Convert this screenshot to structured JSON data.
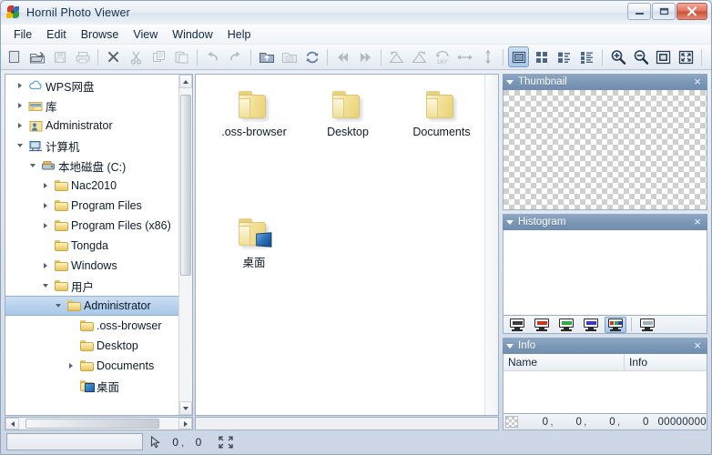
{
  "window": {
    "title": "Hornil Photo Viewer",
    "logo_icon": "hornil-pinwheel-icon",
    "minimize_label": "Minimize",
    "maximize_label": "Maximize",
    "close_label": "Close"
  },
  "menubar": {
    "items": [
      {
        "label": "File"
      },
      {
        "label": "Edit"
      },
      {
        "label": "Browse"
      },
      {
        "label": "View"
      },
      {
        "label": "Window"
      },
      {
        "label": "Help"
      }
    ]
  },
  "toolbar": {
    "groups": [
      {
        "buttons": [
          {
            "icon": "new-document-icon",
            "tip": "New",
            "enabled": true,
            "selected": false
          },
          {
            "icon": "open-folder-icon",
            "tip": "Open",
            "enabled": true,
            "selected": false
          },
          {
            "icon": "save-floppy-icon",
            "tip": "Save",
            "enabled": false,
            "selected": false
          },
          {
            "icon": "printer-icon",
            "tip": "Print",
            "enabled": false,
            "selected": false
          }
        ]
      },
      {
        "buttons": [
          {
            "icon": "delete-x-icon",
            "tip": "Delete",
            "enabled": true,
            "selected": false
          },
          {
            "icon": "scissors-cut-icon",
            "tip": "Cut",
            "enabled": false,
            "selected": false
          },
          {
            "icon": "copy-icon",
            "tip": "Copy",
            "enabled": false,
            "selected": false
          },
          {
            "icon": "paste-icon",
            "tip": "Paste",
            "enabled": false,
            "selected": false
          }
        ]
      },
      {
        "buttons": [
          {
            "icon": "undo-arrow-icon",
            "tip": "Undo",
            "enabled": false,
            "selected": false
          },
          {
            "icon": "redo-arrow-icon",
            "tip": "Redo",
            "enabled": false,
            "selected": false
          }
        ]
      },
      {
        "buttons": [
          {
            "icon": "folder-up-icon",
            "tip": "Parent folder",
            "enabled": true,
            "selected": false
          },
          {
            "icon": "folder-image-icon",
            "tip": "Image folder",
            "enabled": false,
            "selected": false
          },
          {
            "icon": "refresh-icon",
            "tip": "Refresh",
            "enabled": true,
            "selected": false
          }
        ]
      },
      {
        "buttons": [
          {
            "icon": "skip-back-icon",
            "tip": "First",
            "enabled": false,
            "selected": false
          },
          {
            "icon": "skip-forward-icon",
            "tip": "Last",
            "enabled": false,
            "selected": false
          }
        ]
      },
      {
        "buttons": [
          {
            "icon": "rotate-left-icon",
            "tip": "Rotate left",
            "enabled": false,
            "selected": false
          },
          {
            "icon": "rotate-right-icon",
            "tip": "Rotate right",
            "enabled": false,
            "selected": false
          },
          {
            "icon": "rotate-180-icon",
            "tip": "Rotate 180",
            "enabled": false,
            "selected": false
          },
          {
            "icon": "flip-horizontal-icon",
            "tip": "Flip horizontal",
            "enabled": false,
            "selected": false
          },
          {
            "icon": "flip-vertical-icon",
            "tip": "Flip vertical",
            "enabled": false,
            "selected": false
          }
        ]
      },
      {
        "buttons": [
          {
            "icon": "view-single-icon",
            "tip": "Single view",
            "enabled": true,
            "selected": true
          },
          {
            "icon": "view-grid-icon",
            "tip": "Thumbnails",
            "enabled": true,
            "selected": false
          },
          {
            "icon": "view-tiles-icon",
            "tip": "Tiles",
            "enabled": true,
            "selected": false
          },
          {
            "icon": "view-details-icon",
            "tip": "Details",
            "enabled": true,
            "selected": false
          }
        ]
      },
      {
        "buttons": [
          {
            "icon": "zoom-in-icon",
            "tip": "Zoom in",
            "enabled": true,
            "selected": false
          },
          {
            "icon": "zoom-out-icon",
            "tip": "Zoom out",
            "enabled": true,
            "selected": false
          },
          {
            "icon": "actual-size-icon",
            "tip": "Actual size",
            "enabled": true,
            "selected": false
          },
          {
            "icon": "fit-screen-icon",
            "tip": "Fit to window",
            "enabled": true,
            "selected": false
          }
        ]
      },
      {
        "buttons": [
          {
            "icon": "pen-tool-icon",
            "tip": "Edit",
            "enabled": false,
            "selected": false
          }
        ]
      }
    ]
  },
  "tree": {
    "rows": [
      {
        "label": "WPS网盘",
        "indent": 0,
        "twisty": "collapsed",
        "icon": "cloud-drive-icon",
        "selected": false
      },
      {
        "label": "库",
        "indent": 0,
        "twisty": "collapsed",
        "icon": "library-icon",
        "selected": false
      },
      {
        "label": "Administrator",
        "indent": 0,
        "twisty": "collapsed",
        "icon": "user-folder-icon",
        "selected": false
      },
      {
        "label": "计算机",
        "indent": 0,
        "twisty": "expanded",
        "icon": "computer-icon",
        "selected": false
      },
      {
        "label": "本地磁盘 (C:)",
        "indent": 1,
        "twisty": "expanded",
        "icon": "hard-disk-icon",
        "selected": false
      },
      {
        "label": "Nac2010",
        "indent": 2,
        "twisty": "collapsed",
        "icon": "folder-icon",
        "selected": false
      },
      {
        "label": "Program Files",
        "indent": 2,
        "twisty": "collapsed",
        "icon": "folder-icon",
        "selected": false
      },
      {
        "label": "Program Files (x86)",
        "indent": 2,
        "twisty": "collapsed",
        "icon": "folder-icon",
        "selected": false
      },
      {
        "label": "Tongda",
        "indent": 2,
        "twisty": "none",
        "icon": "folder-icon",
        "selected": false
      },
      {
        "label": "Windows",
        "indent": 2,
        "twisty": "collapsed",
        "icon": "folder-icon",
        "selected": false
      },
      {
        "label": "用户",
        "indent": 2,
        "twisty": "expanded",
        "icon": "folder-icon",
        "selected": false
      },
      {
        "label": "Administrator",
        "indent": 3,
        "twisty": "expanded",
        "icon": "folder-icon",
        "selected": true
      },
      {
        "label": ".oss-browser",
        "indent": 4,
        "twisty": "none",
        "icon": "folder-icon",
        "selected": false
      },
      {
        "label": "Desktop",
        "indent": 4,
        "twisty": "none",
        "icon": "folder-icon",
        "selected": false
      },
      {
        "label": "Documents",
        "indent": 4,
        "twisty": "collapsed",
        "icon": "folder-icon",
        "selected": false
      },
      {
        "label": "桌面",
        "indent": 4,
        "twisty": "none",
        "icon": "desktop-folder-icon",
        "selected": false
      }
    ],
    "vscroll": {
      "thumb_top_pct": 2,
      "thumb_height_pct": 58
    },
    "hscroll": {
      "thumb_left_pct": 4,
      "thumb_width_pct": 84
    }
  },
  "files": {
    "items": [
      {
        "label": ".oss-browser",
        "icon": "folder-icon",
        "col": 0,
        "row": 0
      },
      {
        "label": "Desktop",
        "icon": "folder-icon",
        "col": 1,
        "row": 0
      },
      {
        "label": "Documents",
        "icon": "folder-icon",
        "col": 2,
        "row": 0
      },
      {
        "label": "桌面",
        "icon": "desktop-folder-icon",
        "col": 0,
        "row": 1
      }
    ]
  },
  "dock": {
    "thumbnail": {
      "title": "Thumbnail",
      "close_label": "×",
      "collapse_icon": "caret-down-icon",
      "empty": true
    },
    "histogram": {
      "title": "Histogram",
      "close_label": "×",
      "collapse_icon": "caret-down-icon",
      "channels": [
        {
          "name": "channel-gray",
          "color": "#3a3a3a",
          "selected": false
        },
        {
          "name": "channel-red",
          "color": "#e02b1c",
          "selected": false
        },
        {
          "name": "channel-green",
          "color": "#23b23a",
          "selected": false
        },
        {
          "name": "channel-blue",
          "color": "#3a35cf",
          "selected": false
        },
        {
          "name": "channel-rgb",
          "color": "#rgb",
          "selected": true
        },
        {
          "name": "channel-alpha",
          "color": "#8aa0b8",
          "selected": false
        }
      ]
    },
    "info": {
      "title": "Info",
      "close_label": "×",
      "collapse_icon": "caret-down-icon",
      "columns": [
        "Name",
        "Info"
      ],
      "rows": []
    },
    "pixel_status": {
      "swatch_icon": "transparent-swatch-icon",
      "r": "0",
      "g": "0",
      "b": "0",
      "a": "0",
      "sep": ",",
      "hex": "00000000"
    }
  },
  "statusbar": {
    "field_value": "",
    "cursor_icon": "mouse-pointer-icon",
    "x": "0",
    "y": "0",
    "sep": ",",
    "fit_icon": "fit-screen-icon"
  },
  "colors": {
    "accent": "#7b98b7",
    "selection": "#a8c8e8",
    "folder": "#ead37a",
    "frame": "#9db0c6",
    "close_red": "#cf4f36"
  }
}
